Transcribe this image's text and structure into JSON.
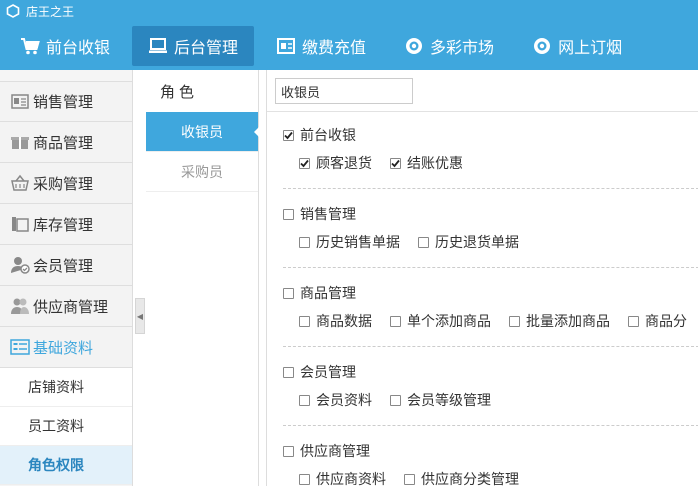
{
  "window": {
    "title": "店王之王"
  },
  "topnav": [
    {
      "label": "前台收银",
      "icon": "cart-icon",
      "active": false
    },
    {
      "label": "后台管理",
      "icon": "monitor-icon",
      "active": true
    },
    {
      "label": "缴费充值",
      "icon": "bill-icon",
      "active": false
    },
    {
      "label": "多彩市场",
      "icon": "circle-target-icon",
      "active": false
    },
    {
      "label": "网上订烟",
      "icon": "circle-target-icon",
      "active": false
    }
  ],
  "sidebar": {
    "groups": [
      {
        "label": "销售管理",
        "icon": "receipt-icon"
      },
      {
        "label": "商品管理",
        "icon": "gift-icon"
      },
      {
        "label": "采购管理",
        "icon": "basket-icon"
      },
      {
        "label": "库存管理",
        "icon": "copy-icon"
      },
      {
        "label": "会员管理",
        "icon": "member-icon"
      },
      {
        "label": "供应商管理",
        "icon": "users-icon"
      },
      {
        "label": "基础资料",
        "icon": "list-icon"
      }
    ],
    "subitems": [
      {
        "label": "店铺资料"
      },
      {
        "label": "员工资料"
      },
      {
        "label": "角色权限"
      }
    ]
  },
  "roles": {
    "header": "角色",
    "items": [
      {
        "label": "收银员"
      },
      {
        "label": "采购员"
      }
    ]
  },
  "panel": {
    "role_name": "收银员",
    "groups": [
      {
        "label": "前台收银",
        "checked": true,
        "items": [
          {
            "label": "顾客退货",
            "checked": true
          },
          {
            "label": "结账优惠",
            "checked": true
          }
        ]
      },
      {
        "label": "销售管理",
        "checked": false,
        "items": [
          {
            "label": "历史销售单据",
            "checked": false
          },
          {
            "label": "历史退货单据",
            "checked": false
          }
        ]
      },
      {
        "label": "商品管理",
        "checked": false,
        "items": [
          {
            "label": "商品数据",
            "checked": false
          },
          {
            "label": "单个添加商品",
            "checked": false
          },
          {
            "label": "批量添加商品",
            "checked": false
          },
          {
            "label": "商品分",
            "checked": false
          }
        ]
      },
      {
        "label": "会员管理",
        "checked": false,
        "items": [
          {
            "label": "会员资料",
            "checked": false
          },
          {
            "label": "会员等级管理",
            "checked": false
          }
        ]
      },
      {
        "label": "供应商管理",
        "checked": false,
        "items": [
          {
            "label": "供应商资料",
            "checked": false
          },
          {
            "label": "供应商分类管理",
            "checked": false
          }
        ]
      }
    ]
  },
  "colors": {
    "accent": "#3fa7dd",
    "accent_dark": "#2b86bf"
  }
}
